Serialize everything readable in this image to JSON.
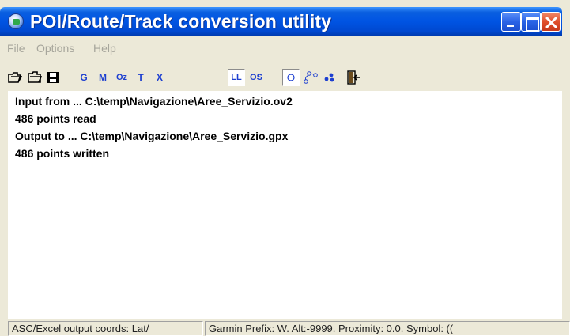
{
  "window": {
    "title": "POI/Route/Track conversion utility",
    "title_bar_color": "#0054e3",
    "close_button_color": "#e0502c"
  },
  "menu": {
    "items": [
      {
        "label": "File"
      },
      {
        "label": "Options"
      },
      {
        "label": "Help"
      }
    ],
    "disabled_color": "#a7a69c"
  },
  "toolbar": {
    "buttons": [
      {
        "name": "open-folder",
        "label": ""
      },
      {
        "name": "open-file",
        "label": ""
      },
      {
        "name": "save",
        "label": ""
      },
      {
        "name": "format-g",
        "label": "G"
      },
      {
        "name": "format-m",
        "label": "M"
      },
      {
        "name": "format-oz",
        "label": "Oz"
      },
      {
        "name": "format-t",
        "label": "T"
      },
      {
        "name": "format-x",
        "label": "X"
      },
      {
        "name": "coords-ll",
        "label": "LL",
        "pressed": true
      },
      {
        "name": "coords-os",
        "label": "OS"
      },
      {
        "name": "mode-point",
        "label": "",
        "pressed": true
      },
      {
        "name": "mode-route",
        "label": ""
      },
      {
        "name": "mode-track",
        "label": ""
      },
      {
        "name": "exit",
        "label": ""
      }
    ],
    "label_color": "#1d3fd0"
  },
  "log": {
    "lines": [
      "Input from ... C:\\temp\\Navigazione\\Aree_Servizio.ov2",
      "486 points read",
      "Output to ... C:\\temp\\Navigazione\\Aree_Servizio.gpx",
      "486 points written"
    ]
  },
  "status": {
    "panel1": "ASC/Excel output coords: Lat/",
    "panel2": "Garmin Prefix: W. Alt:-9999. Proximity:    0.0. Symbol: (("
  }
}
